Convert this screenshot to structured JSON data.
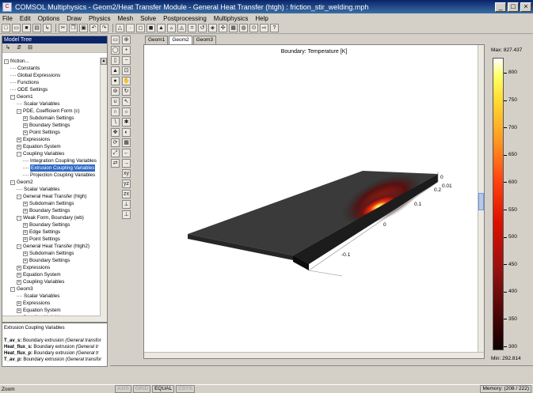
{
  "window": {
    "title": "COMSOL Multiphysics - Geom2/Heat Transfer Module - General Heat Transfer (htgh) : friction_stir_welding.mph",
    "icon": "comsol-icon"
  },
  "menu": [
    "File",
    "Edit",
    "Options",
    "Draw",
    "Physics",
    "Mesh",
    "Solve",
    "Postprocessing",
    "Multiphysics",
    "Help"
  ],
  "model_tree": {
    "header": "Model Tree",
    "items": [
      {
        "label": "friction...",
        "depth": 0,
        "exp": "-"
      },
      {
        "label": "Constants",
        "depth": 1,
        "exp": ""
      },
      {
        "label": "Global Expressions",
        "depth": 1,
        "exp": ""
      },
      {
        "label": "Functions",
        "depth": 1,
        "exp": ""
      },
      {
        "label": "ODE Settings",
        "depth": 1,
        "exp": ""
      },
      {
        "label": "Geom1",
        "depth": 1,
        "exp": "-"
      },
      {
        "label": "Scalar Variables",
        "depth": 2,
        "exp": ""
      },
      {
        "label": "PDE, Coefficient Form (c)",
        "depth": 2,
        "exp": "-"
      },
      {
        "label": "Subdomain Settings",
        "depth": 3,
        "exp": "+"
      },
      {
        "label": "Boundary Settings",
        "depth": 3,
        "exp": "+"
      },
      {
        "label": "Point Settings",
        "depth": 3,
        "exp": "+"
      },
      {
        "label": "Expressions",
        "depth": 2,
        "exp": "+"
      },
      {
        "label": "Equation System",
        "depth": 2,
        "exp": "+"
      },
      {
        "label": "Coupling Variables",
        "depth": 2,
        "exp": "-"
      },
      {
        "label": "Integration Coupling Variables",
        "depth": 3,
        "exp": ""
      },
      {
        "label": "Extrusion Coupling Variables",
        "depth": 3,
        "exp": "",
        "selected": true
      },
      {
        "label": "Projection Coupling Variables",
        "depth": 3,
        "exp": ""
      },
      {
        "label": "Geom2",
        "depth": 1,
        "exp": "-"
      },
      {
        "label": "Scalar Variables",
        "depth": 2,
        "exp": ""
      },
      {
        "label": "General Heat Transfer (htgh)",
        "depth": 2,
        "exp": "-"
      },
      {
        "label": "Subdomain Settings",
        "depth": 3,
        "exp": "+"
      },
      {
        "label": "Boundary Settings",
        "depth": 3,
        "exp": "+"
      },
      {
        "label": "Weak Form, Boundary (wb)",
        "depth": 2,
        "exp": "-"
      },
      {
        "label": "Boundary Settings",
        "depth": 3,
        "exp": "+"
      },
      {
        "label": "Edge Settings",
        "depth": 3,
        "exp": "+"
      },
      {
        "label": "Point Settings",
        "depth": 3,
        "exp": "+"
      },
      {
        "label": "General Heat Transfer (htgh2)",
        "depth": 2,
        "exp": "-"
      },
      {
        "label": "Subdomain Settings",
        "depth": 3,
        "exp": "+"
      },
      {
        "label": "Boundary Settings",
        "depth": 3,
        "exp": "+"
      },
      {
        "label": "Expressions",
        "depth": 2,
        "exp": "+"
      },
      {
        "label": "Equation System",
        "depth": 2,
        "exp": "+"
      },
      {
        "label": "Coupling Variables",
        "depth": 2,
        "exp": "+"
      },
      {
        "label": "Geom3",
        "depth": 1,
        "exp": "-"
      },
      {
        "label": "Scalar Variables",
        "depth": 2,
        "exp": ""
      },
      {
        "label": "Expressions",
        "depth": 2,
        "exp": "+"
      },
      {
        "label": "Equation System",
        "depth": 2,
        "exp": "+"
      },
      {
        "label": "Coupling Variables",
        "depth": 2,
        "exp": "+"
      }
    ]
  },
  "info": {
    "title": "Extrusion Coupling Variables",
    "lines": [
      {
        "name": "T_av_s:",
        "text": " Boundary extrusion ",
        "note": "(General transfor"
      },
      {
        "name": "Heat_flux_s:",
        "text": " Boundary extrusion ",
        "note": "(General tr"
      },
      {
        "name": "Heat_flux_p:",
        "text": " Boundary extrusion ",
        "note": "(General tr"
      },
      {
        "name": "T_av_p:",
        "text": " Boundary extrusion ",
        "note": "(General transfor"
      }
    ]
  },
  "tabs": [
    "Geom1",
    "Geom2",
    "Geom3"
  ],
  "active_tab": "Geom2",
  "plot": {
    "title": "Boundary: Temperature [K]",
    "axis_ticks": [
      "-0.1",
      "0",
      "0.1",
      "0.2",
      "0",
      "0.01"
    ]
  },
  "colorbar": {
    "max_label": "Max: 827.437",
    "min_label": "Min: 292.814",
    "max": 827.437,
    "min": 292.814,
    "ticks": [
      "800",
      "750",
      "700",
      "650",
      "600",
      "550",
      "500",
      "450",
      "400",
      "350",
      "300"
    ]
  },
  "status": {
    "zoom": "Zoom",
    "toggles": [
      "AXIS",
      "GRID",
      "EQUAL",
      "CSYS"
    ],
    "active_toggle": "EQUAL",
    "memory": "Memory: (208 / 222)"
  }
}
